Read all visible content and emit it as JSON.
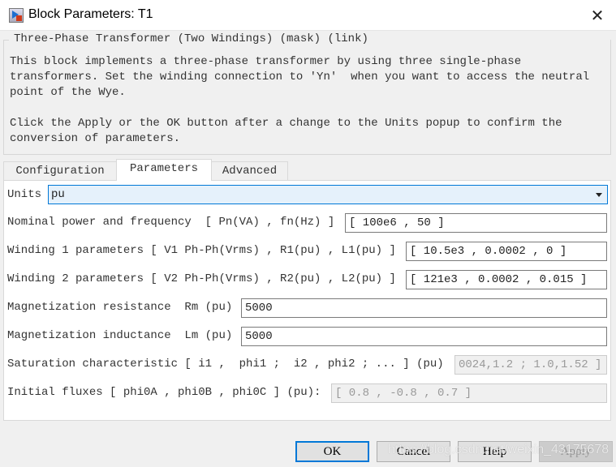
{
  "window": {
    "title": "Block Parameters: T1",
    "icon": "simulink-block-icon",
    "close_icon": "close-icon"
  },
  "group": {
    "title": "Three-Phase Transformer (Two Windings) (mask) (link)",
    "description": "This block implements a three-phase transformer by using three single-phase\ntransformers. Set the winding connection to 'Yn'  when you want to access the neutral\npoint of the Wye.\n\nClick the Apply or the OK button after a change to the Units popup to confirm the\nconversion of parameters."
  },
  "tabs": [
    {
      "label": "Configuration"
    },
    {
      "label": "Parameters",
      "active": true
    },
    {
      "label": "Advanced"
    }
  ],
  "units": {
    "label": "Units",
    "value": "pu"
  },
  "params": [
    {
      "label": "Nominal power and frequency  [ Pn(VA) , fn(Hz) ]",
      "value": "[ 100e6 , 50 ]",
      "enabled": true
    },
    {
      "label": "Winding 1 parameters [ V1 Ph-Ph(Vrms) , R1(pu) , L1(pu) ]",
      "value": "[ 10.5e3 , 0.0002 , 0 ]",
      "enabled": true
    },
    {
      "label": "Winding 2 parameters [ V2 Ph-Ph(Vrms) , R2(pu) , L2(pu) ]",
      "value": "[ 121e3 , 0.0002 , 0.015 ]",
      "enabled": true
    },
    {
      "label": "Magnetization resistance  Rm (pu)",
      "value": "5000",
      "enabled": true
    },
    {
      "label": "Magnetization inductance  Lm (pu)",
      "value": "5000",
      "enabled": true
    },
    {
      "label": "Saturation characteristic [ i1 ,  phi1 ;  i2 , phi2 ; ... ] (pu)",
      "value": "0024,1.2 ; 1.0,1.52 ]",
      "enabled": false
    },
    {
      "label": "Initial fluxes [ phi0A , phi0B , phi0C ] (pu):",
      "value": "[ 0.8 , -0.8 , 0.7 ]",
      "enabled": false
    }
  ],
  "buttons": {
    "ok": "OK",
    "cancel": "Cancel",
    "help": "Help",
    "apply": "Apply"
  },
  "watermark": "https://blog.csdn.net/weixin_43175678"
}
